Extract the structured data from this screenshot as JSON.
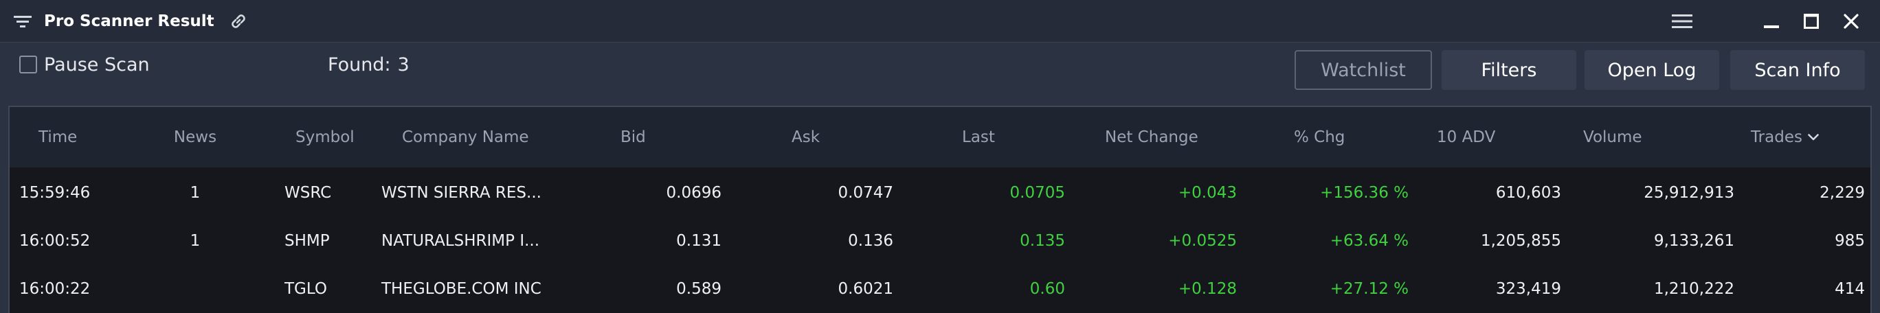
{
  "window": {
    "title": "Pro Scanner Result",
    "icons": [
      "filter-icon",
      "link-icon",
      "hamburger-menu-icon",
      "minimize-icon",
      "maximize-icon",
      "close-icon"
    ]
  },
  "controls": {
    "pause_label": "Pause Scan",
    "pause_checked": false,
    "found_label": "Found:",
    "found_count": "3",
    "buttons": {
      "watchlist": "Watchlist",
      "filters": "Filters",
      "open_log": "Open Log",
      "scan_info": "Scan Info"
    }
  },
  "table": {
    "columns": {
      "time": "Time",
      "news": "News",
      "symbol": "Symbol",
      "company": "Company Name",
      "bid": "Bid",
      "ask": "Ask",
      "last": "Last",
      "net_change": "Net Change",
      "pct_chg": "% Chg",
      "adv10": "10 ADV",
      "volume": "Volume",
      "trades": "Trades"
    },
    "sort": {
      "column": "trades",
      "direction": "descending"
    },
    "rows": [
      {
        "time": "15:59:46",
        "news": "1",
        "symbol": "WSRC",
        "company": "WSTN SIERRA RES...",
        "bid": "0.0696",
        "ask": "0.0747",
        "last": "0.0705",
        "net_change": "+0.043",
        "pct_chg": "+156.36 %",
        "adv10": "610,603",
        "volume": "25,912,913",
        "trades": "2,229"
      },
      {
        "time": "16:00:52",
        "news": "1",
        "symbol": "SHMP",
        "company": "NATURALSHRIMP I...",
        "bid": "0.131",
        "ask": "0.136",
        "last": "0.135",
        "net_change": "+0.0525",
        "pct_chg": "+63.64 %",
        "adv10": "1,205,855",
        "volume": "9,133,261",
        "trades": "985"
      },
      {
        "time": "16:00:22",
        "news": "",
        "symbol": "TGLO",
        "company": "THEGLOBE.COM INC",
        "bid": "0.589",
        "ask": "0.6021",
        "last": "0.60",
        "net_change": "+0.128",
        "pct_chg": "+27.12 %",
        "adv10": "323,419",
        "volume": "1,210,222",
        "trades": "414"
      }
    ]
  },
  "colors": {
    "background": "#2b3242",
    "titlebar": "#252b39",
    "table_body": "#15171c",
    "positive": "#3fd13f",
    "header_text": "#9ba3b2"
  }
}
